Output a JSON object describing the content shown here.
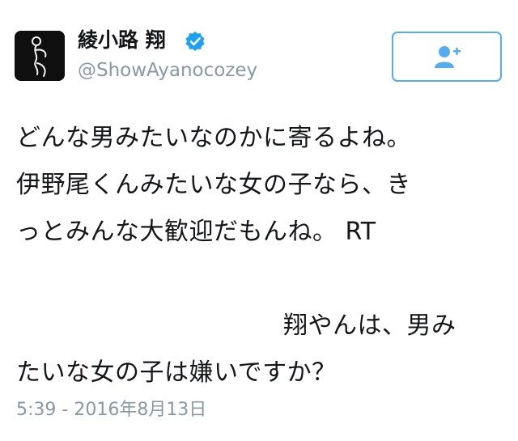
{
  "user": {
    "display_name": "綾小路 翔",
    "handle": "@ShowAyanocozey",
    "verified": true,
    "avatar_icon": "silhouette-figure-avatar"
  },
  "follow_button": {
    "icon": "add-user-icon",
    "accent_color": "#55acee"
  },
  "tweet": {
    "lines": [
      "どんな男みたいなのかに寄るよね。",
      "伊野尾くんみたいな女の子なら、き",
      "っとみんな大歓迎だもんね。 RT",
      "",
      "翔やんは、男み",
      "たいな女の子は嫌いですか？"
    ],
    "timestamp": "5:39 - 2016年8月13日"
  }
}
